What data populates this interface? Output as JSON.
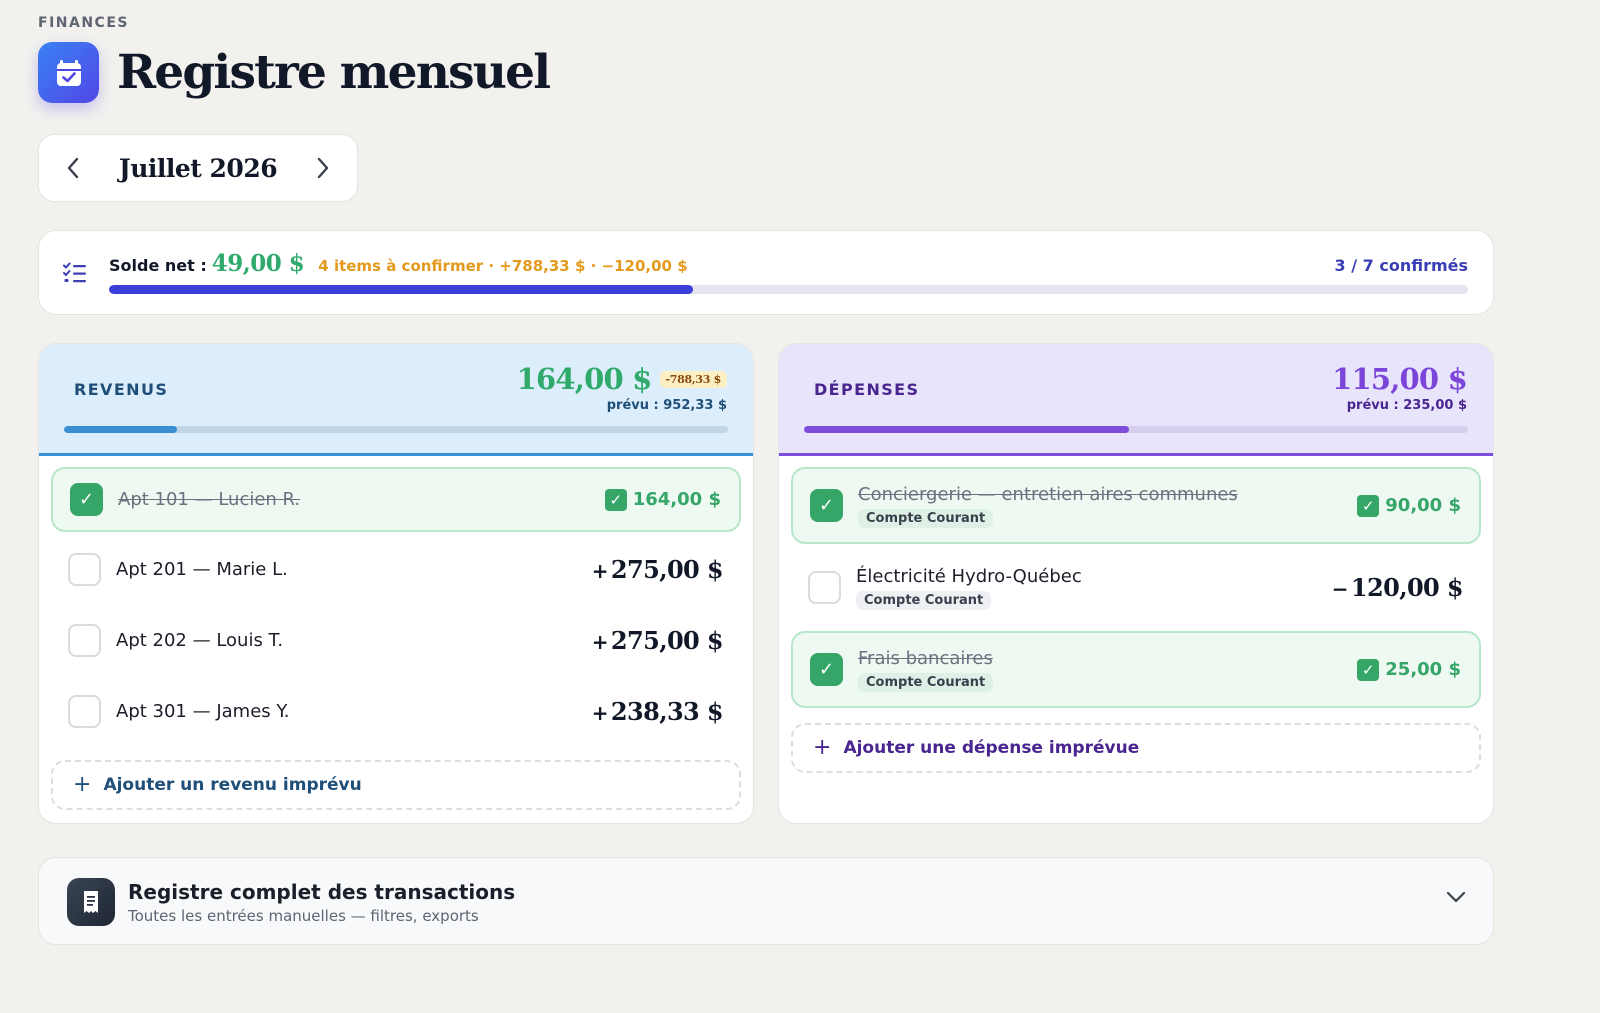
{
  "header": {
    "section_label": "FINANCES",
    "title": "Registre mensuel",
    "icon": "calendar-check-icon"
  },
  "month": {
    "label": "Juillet 2026"
  },
  "summary": {
    "net_label": "Solde net :",
    "net_value": "49,00 $",
    "pending": "4 items à confirmer · +788,33 $ · −120,00 $",
    "confirmed": "3 / 7 confirmés",
    "progress": 0.43
  },
  "revenus": {
    "title": "REVENUS",
    "total": "164,00 $",
    "delta": "-788,33 $",
    "forecast": "prévu : 952,33 $",
    "progress": 0.17,
    "items": [
      {
        "name": "Apt 101 — Lucien R.",
        "amount": "164,00 $",
        "done": true
      },
      {
        "name": "Apt 201 — Marie L.",
        "sign": "+",
        "amount": "275,00 $",
        "done": false
      },
      {
        "name": "Apt 202 — Louis T.",
        "sign": "+",
        "amount": "275,00 $",
        "done": false
      },
      {
        "name": "Apt 301 — James Y.",
        "sign": "+",
        "amount": "238,33 $",
        "done": false
      }
    ],
    "add_label": "Ajouter un revenu imprévu"
  },
  "depenses": {
    "title": "DÉPENSES",
    "total": "115,00 $",
    "forecast": "prévu : 235,00 $",
    "progress": 0.49,
    "items": [
      {
        "name": "Conciergerie — entretien aires communes",
        "tag": "Compte Courant",
        "amount": "90,00 $",
        "done": true
      },
      {
        "name": "Électricité Hydro-Québec",
        "tag": "Compte Courant",
        "sign": "−",
        "amount": "120,00 $",
        "done": false
      },
      {
        "name": "Frais bancaires",
        "tag": "Compte Courant",
        "amount": "25,00 $",
        "done": true
      }
    ],
    "add_label": "Ajouter une dépense imprévue"
  },
  "registry": {
    "title": "Registre complet des transactions",
    "subtitle": "Toutes les entrées manuelles — filtres, exports"
  },
  "colors": {
    "accent": "#3b3fd8",
    "positive": "#2faa6b",
    "pending": "#e39a1c",
    "revenus": "#3b8fd0",
    "depenses": "#7c4ddb"
  }
}
